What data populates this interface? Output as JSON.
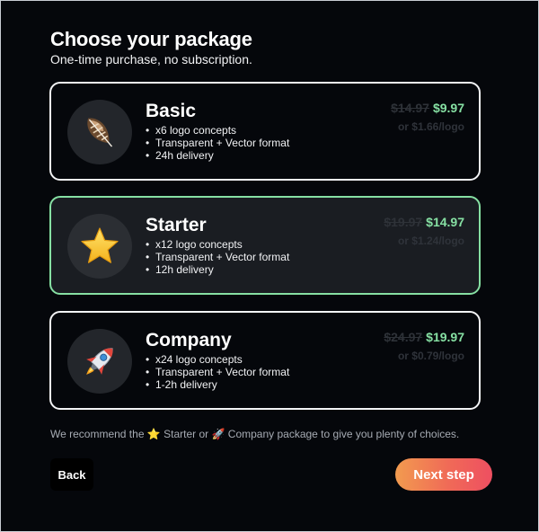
{
  "header": {
    "title": "Choose your package",
    "subtitle": "One-time purchase, no subscription."
  },
  "packages": [
    {
      "name": "Basic",
      "icon": "feather-icon",
      "features": [
        "x6 logo concepts",
        "Transparent + Vector format",
        "24h delivery"
      ],
      "old_price": "$14.97",
      "price": "$9.97",
      "per_logo": "or $1.66/logo",
      "selected": false
    },
    {
      "name": "Starter",
      "icon": "star-icon",
      "features": [
        "x12 logo concepts",
        "Transparent + Vector format",
        "12h delivery"
      ],
      "old_price": "$19.97",
      "price": "$14.97",
      "per_logo": "or $1.24/logo",
      "selected": true
    },
    {
      "name": "Company",
      "icon": "rocket-icon",
      "features": [
        "x24 logo concepts",
        "Transparent + Vector format",
        "1-2h delivery"
      ],
      "old_price": "$24.97",
      "price": "$19.97",
      "per_logo": "or $0.79/logo",
      "selected": false
    }
  ],
  "recommendation": {
    "prefix": "We recommend the ",
    "starter": "Starter",
    "middle": " or ",
    "company": "Company",
    "suffix": " package to give you plenty of choices."
  },
  "actions": {
    "back_label": "Back",
    "next_label": "Next step"
  },
  "colors": {
    "accent_green": "#86e0a3",
    "button_gradient_start": "#f29b4f",
    "button_gradient_end": "#ee4f61",
    "background": "#05070b"
  }
}
